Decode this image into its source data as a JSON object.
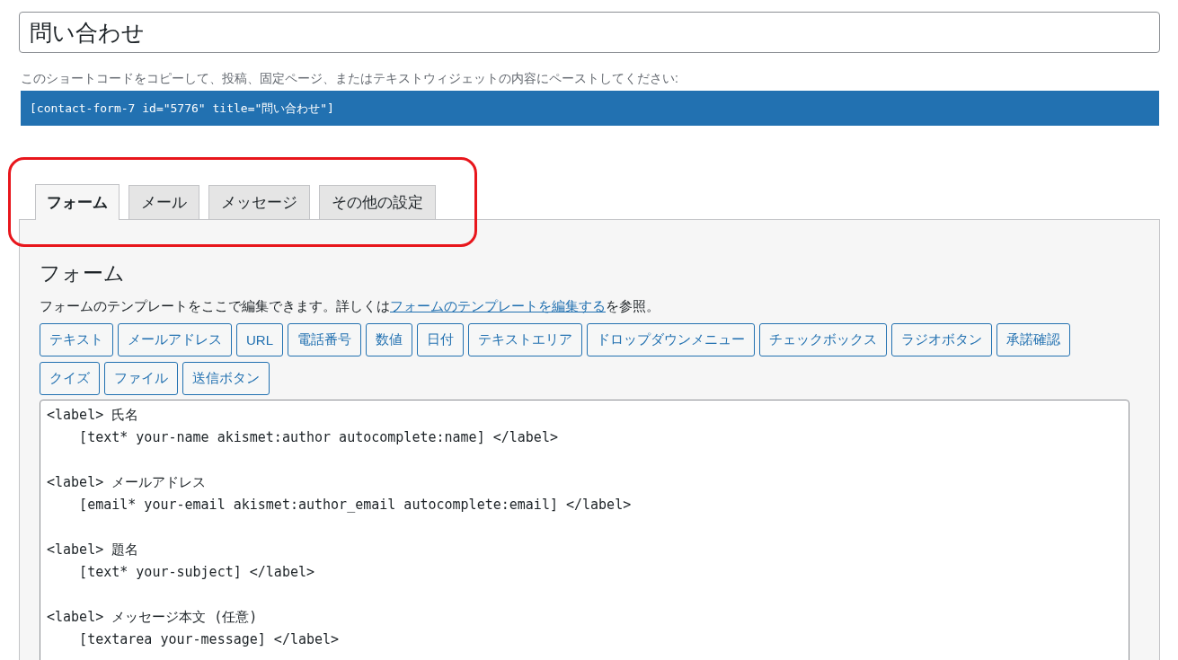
{
  "title_field": {
    "value": "問い合わせ"
  },
  "shortcode_hint": "このショートコードをコピーして、投稿、固定ページ、またはテキストウィジェットの内容にペーストしてください:",
  "shortcode": "[contact-form-7 id=\"5776\" title=\"問い合わせ\"]",
  "tabs": [
    {
      "label": "フォーム",
      "selected": true
    },
    {
      "label": "メール",
      "selected": false
    },
    {
      "label": "メッセージ",
      "selected": false
    },
    {
      "label": "その他の設定",
      "selected": false
    }
  ],
  "panel": {
    "heading": "フォーム",
    "description_before": "フォームのテンプレートをここで編集できます。詳しくは",
    "description_link": "フォームのテンプレートを編集する",
    "description_after": "を参照。",
    "tag_buttons": [
      "テキスト",
      "メールアドレス",
      "URL",
      "電話番号",
      "数値",
      "日付",
      "テキストエリア",
      "ドロップダウンメニュー",
      "チェックボックス",
      "ラジオボタン",
      "承諾確認",
      "クイズ",
      "ファイル",
      "送信ボタン"
    ],
    "template": "<label> 氏名\n    [text* your-name akismet:author autocomplete:name] </label>\n\n<label> メールアドレス\n    [email* your-email akismet:author_email autocomplete:email] </label>\n\n<label> 題名\n    [text* your-subject] </label>\n\n<label> メッセージ本文 (任意)\n    [textarea your-message] </label>"
  }
}
